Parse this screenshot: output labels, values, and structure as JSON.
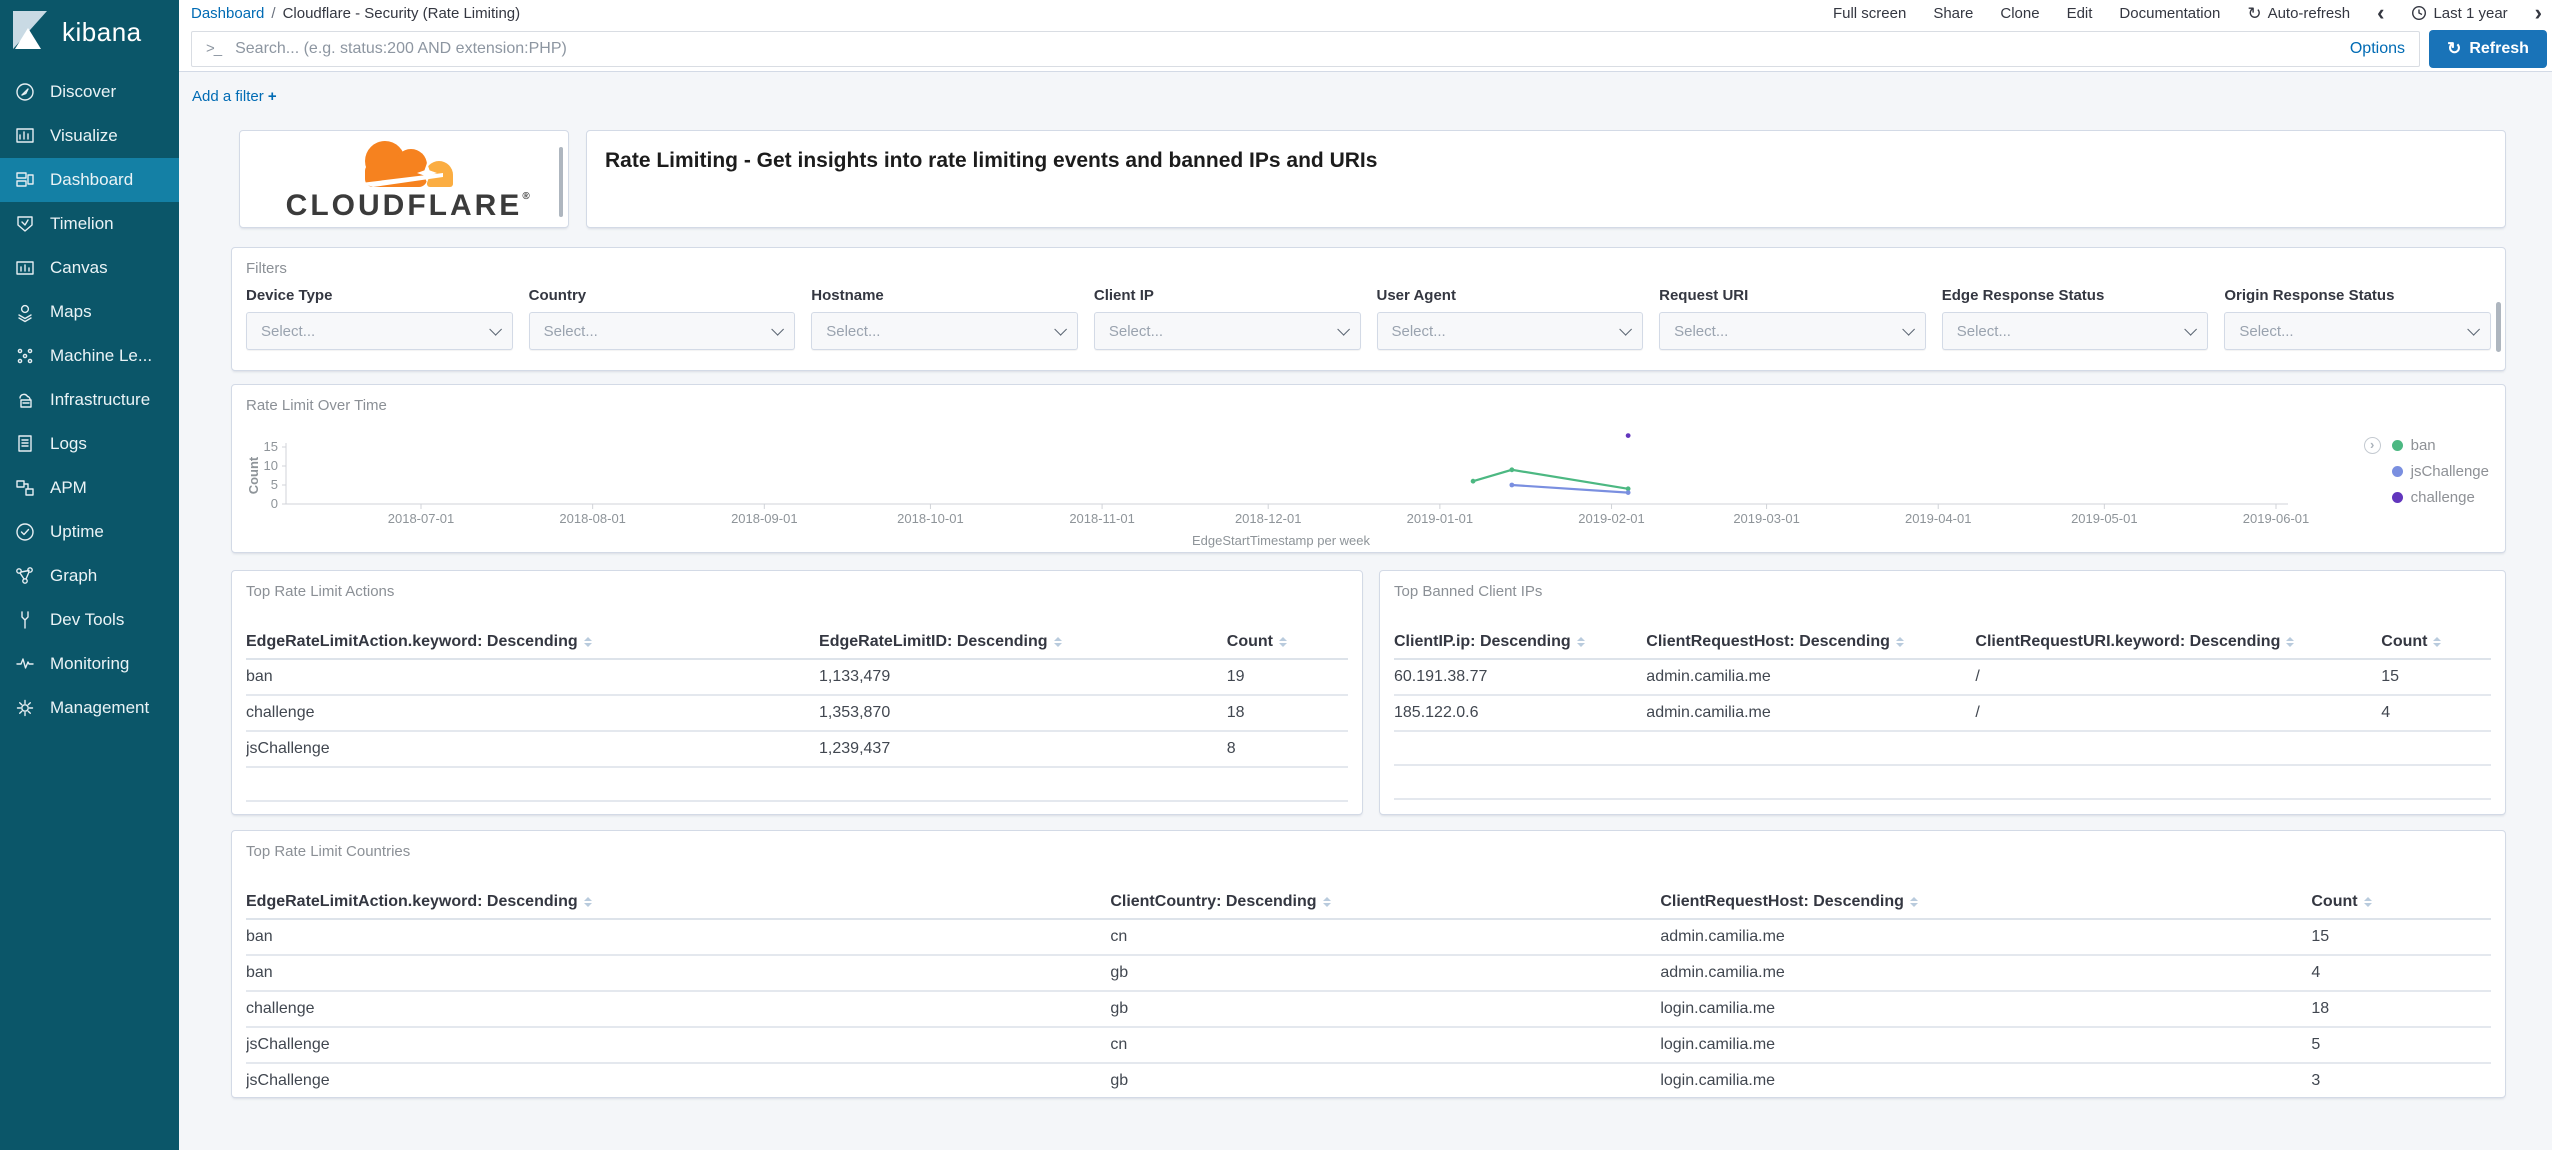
{
  "colors": {
    "accent_blue": "#006BB4",
    "refresh_button": "#1973b8",
    "sidebar_bg": "#0b5669",
    "sidebar_selected_bg": "#1480a5",
    "cloudflare_orange": "#F6821F",
    "cloudflare_light_orange": "#FBAD41"
  },
  "sidebar": {
    "logo_text": "kibana",
    "items": [
      {
        "label": "Discover",
        "icon": "compass-icon",
        "active": false
      },
      {
        "label": "Visualize",
        "icon": "bar-chart-icon",
        "active": false
      },
      {
        "label": "Dashboard",
        "icon": "dashboard-grid-icon",
        "active": true
      },
      {
        "label": "Timelion",
        "icon": "timelion-shield-icon",
        "active": false
      },
      {
        "label": "Canvas",
        "icon": "canvas-frame-icon",
        "active": false
      },
      {
        "label": "Maps",
        "icon": "map-pin-icon",
        "active": false
      },
      {
        "label": "Machine Le...",
        "icon": "machine-learning-icon",
        "active": false
      },
      {
        "label": "Infrastructure",
        "icon": "infrastructure-cloud-icon",
        "active": false
      },
      {
        "label": "Logs",
        "icon": "logs-document-icon",
        "active": false
      },
      {
        "label": "APM",
        "icon": "apm-nodes-icon",
        "active": false
      },
      {
        "label": "Uptime",
        "icon": "uptime-check-icon",
        "active": false
      },
      {
        "label": "Graph",
        "icon": "graph-network-icon",
        "active": false
      },
      {
        "label": "Dev Tools",
        "icon": "wrench-icon",
        "active": false
      },
      {
        "label": "Monitoring",
        "icon": "heartbeat-icon",
        "active": false
      },
      {
        "label": "Management",
        "icon": "gear-icon",
        "active": false
      }
    ]
  },
  "topnav": {
    "breadcrumb": {
      "link": "Dashboard",
      "separator": "/",
      "current": "Cloudflare - Security (Rate Limiting)"
    },
    "items": [
      "Full screen",
      "Share",
      "Clone",
      "Edit",
      "Documentation"
    ],
    "auto_refresh": "Auto-refresh",
    "time_range": "Last 1 year",
    "prev_chevron": "‹",
    "next_chevron": "›"
  },
  "searchbar": {
    "prompt": ">_",
    "placeholder": "Search... (e.g. status:200 AND extension:PHP)",
    "options": "Options",
    "refresh": "Refresh",
    "refresh_glyph": "↻"
  },
  "filter_bar": {
    "add_filter": "Add a filter",
    "plus": "+"
  },
  "header_panel": {
    "wordmark": "CLOUDFLARE",
    "registered_mark": "®",
    "description": "Rate Limiting - Get insights into rate limiting events and banned IPs and URIs"
  },
  "filters_panel": {
    "title": "Filters",
    "select_placeholder": "Select...",
    "fields": [
      "Device Type",
      "Country",
      "Hostname",
      "Client IP",
      "User Agent",
      "Request URI",
      "Edge Response Status",
      "Origin Response Status"
    ]
  },
  "chart_panel": {
    "title": "Rate Limit Over Time"
  },
  "chart_data": {
    "type": "line",
    "title": "Rate Limit Over Time",
    "xlabel": "EdgeStartTimestamp per week",
    "ylabel": "Count",
    "ylim": [
      0,
      15
    ],
    "y_ticks": [
      0,
      5,
      10,
      15
    ],
    "x_ticks": [
      "2018-07-01",
      "2018-08-01",
      "2018-09-01",
      "2018-10-01",
      "2018-11-01",
      "2018-12-01",
      "2019-01-01",
      "2019-02-01",
      "2019-03-01",
      "2019-04-01",
      "2019-05-01",
      "2019-06-01"
    ],
    "legend_position": "right",
    "series": [
      {
        "name": "ban",
        "color": "#4cb882",
        "points": [
          [
            "2019-01-07",
            6
          ],
          [
            "2019-01-14",
            9
          ],
          [
            "2019-02-04",
            4
          ]
        ]
      },
      {
        "name": "jsChallenge",
        "color": "#7a8fe0",
        "points": [
          [
            "2019-01-14",
            5
          ],
          [
            "2019-02-04",
            3
          ]
        ]
      },
      {
        "name": "challenge",
        "color": "#6236bd",
        "points": [
          [
            "2019-02-04",
            18
          ]
        ]
      }
    ]
  },
  "tables": {
    "actions": {
      "title": "Top Rate Limit Actions",
      "columns": [
        "EdgeRateLimitAction.keyword: Descending",
        "EdgeRateLimitID: Descending",
        "Count"
      ],
      "rows": [
        [
          "ban",
          "1,133,479",
          "19"
        ],
        [
          "challenge",
          "1,353,870",
          "18"
        ],
        [
          "jsChallenge",
          "1,239,437",
          "8"
        ]
      ]
    },
    "banned_ips": {
      "title": "Top Banned Client IPs",
      "columns": [
        "ClientIP.ip: Descending",
        "ClientRequestHost: Descending",
        "ClientRequestURI.keyword: Descending",
        "Count"
      ],
      "rows": [
        [
          "60.191.38.77",
          "admin.camilia.me",
          "/",
          "15"
        ],
        [
          "185.122.0.6",
          "admin.camilia.me",
          "/",
          "4"
        ]
      ]
    },
    "countries": {
      "title": "Top Rate Limit Countries",
      "columns": [
        "EdgeRateLimitAction.keyword: Descending",
        "ClientCountry: Descending",
        "ClientRequestHost: Descending",
        "Count"
      ],
      "rows": [
        [
          "ban",
          "cn",
          "admin.camilia.me",
          "15"
        ],
        [
          "ban",
          "gb",
          "admin.camilia.me",
          "4"
        ],
        [
          "challenge",
          "gb",
          "login.camilia.me",
          "18"
        ],
        [
          "jsChallenge",
          "cn",
          "login.camilia.me",
          "5"
        ],
        [
          "jsChallenge",
          "gb",
          "login.camilia.me",
          "3"
        ]
      ]
    }
  }
}
